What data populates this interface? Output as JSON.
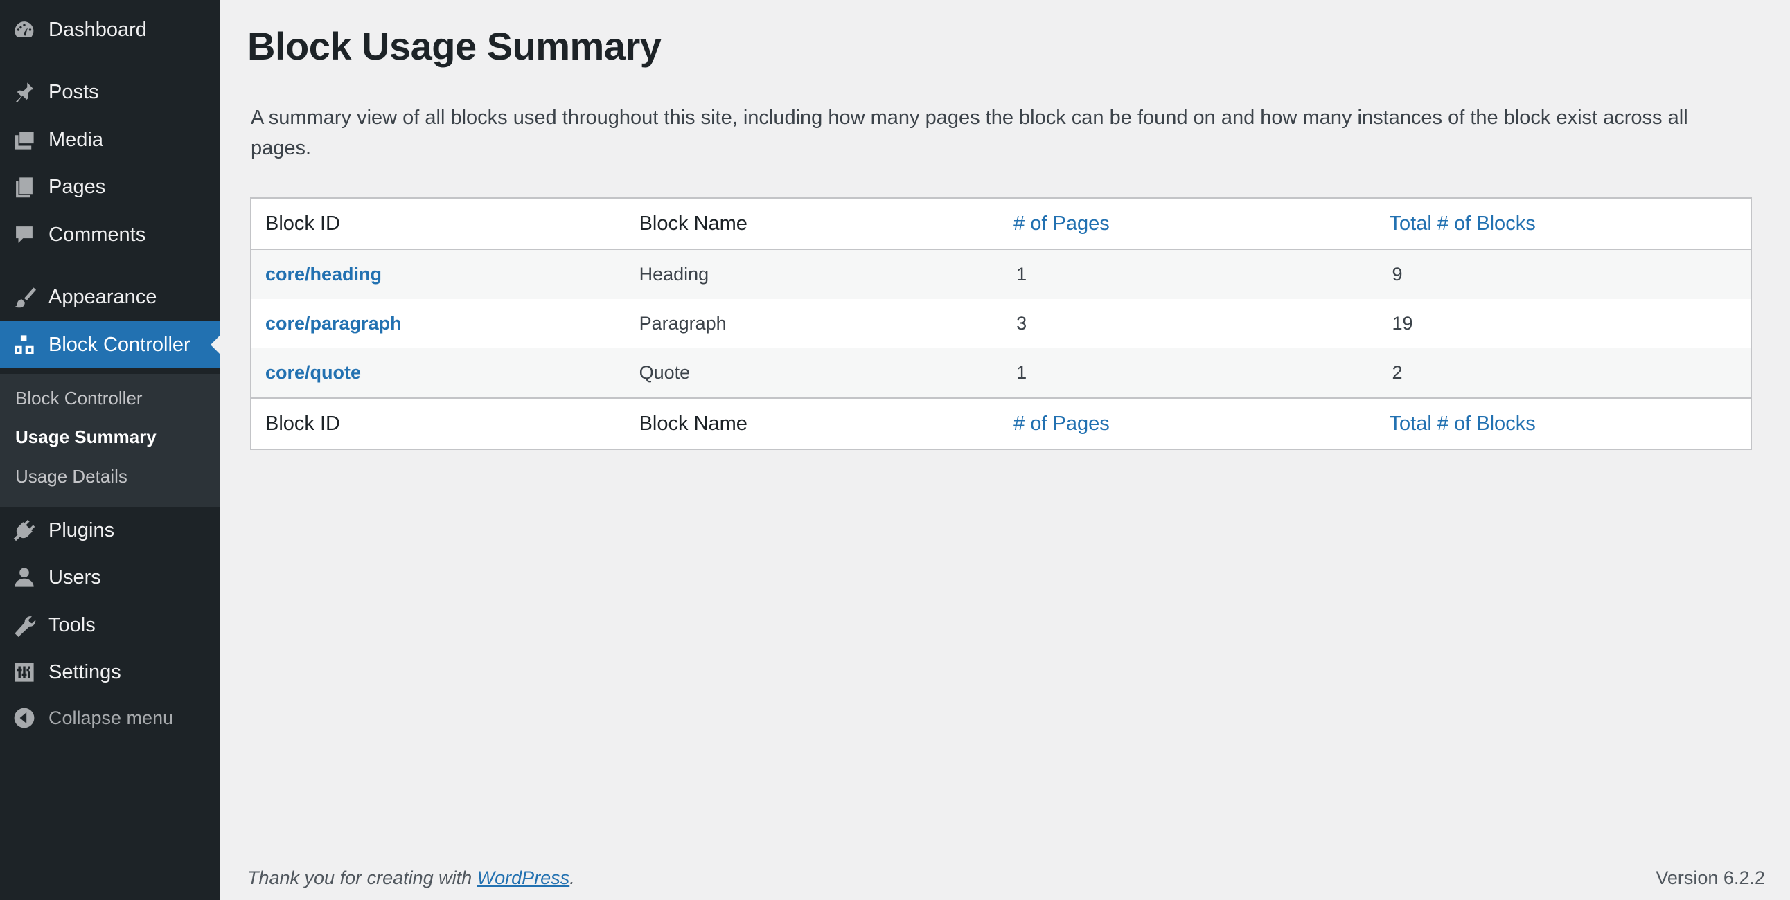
{
  "sidebar": {
    "items": [
      {
        "label": "Dashboard",
        "icon": "dashboard-icon"
      },
      {
        "label": "Posts",
        "icon": "pin-icon"
      },
      {
        "label": "Media",
        "icon": "media-icon"
      },
      {
        "label": "Pages",
        "icon": "pages-icon"
      },
      {
        "label": "Comments",
        "icon": "comment-icon"
      },
      {
        "label": "Appearance",
        "icon": "brush-icon"
      },
      {
        "label": "Block Controller",
        "icon": "blocks-icon"
      },
      {
        "label": "Plugins",
        "icon": "plugin-icon"
      },
      {
        "label": "Users",
        "icon": "user-icon"
      },
      {
        "label": "Tools",
        "icon": "wrench-icon"
      },
      {
        "label": "Settings",
        "icon": "sliders-icon"
      }
    ],
    "submenu": [
      "Block Controller",
      "Usage Summary",
      "Usage Details"
    ],
    "collapse_label": "Collapse menu"
  },
  "main": {
    "title": "Block Usage Summary",
    "description": "A summary view of all blocks used throughout this site, including how many pages the block can be found on and how many instances of the block exist across all pages.",
    "columns": [
      "Block ID",
      "Block Name",
      "# of Pages",
      "Total # of Blocks"
    ],
    "rows": [
      {
        "id": "core/heading",
        "name": "Heading",
        "pages": "1",
        "total": "9"
      },
      {
        "id": "core/paragraph",
        "name": "Paragraph",
        "pages": "3",
        "total": "19"
      },
      {
        "id": "core/quote",
        "name": "Quote",
        "pages": "1",
        "total": "2"
      }
    ]
  },
  "footer": {
    "thanks_prefix": "Thank you for creating with ",
    "link": "WordPress",
    "suffix": ".",
    "version": "Version 6.2.2"
  },
  "colors": {
    "sidebar_bg": "#1d2327",
    "accent": "#2271b1",
    "page_bg": "#f0f0f1"
  }
}
